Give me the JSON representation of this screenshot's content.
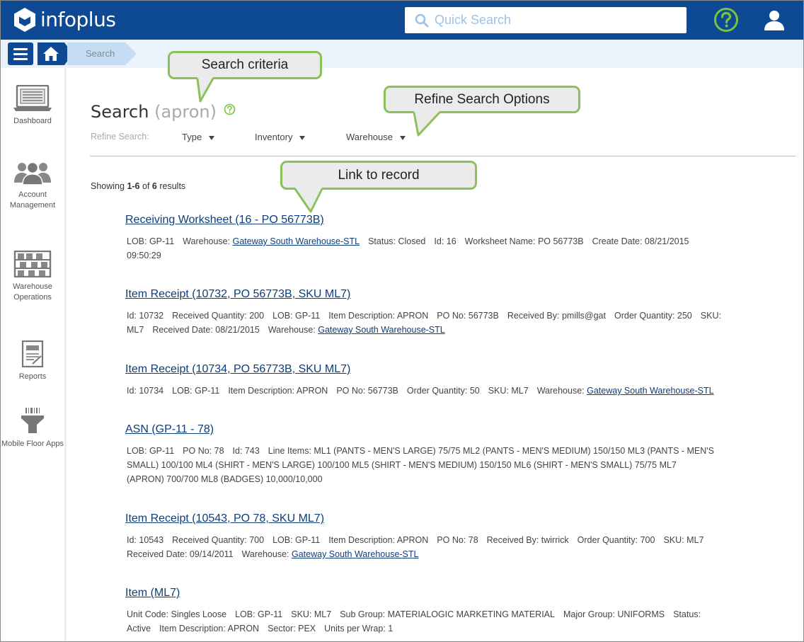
{
  "app": {
    "logo_text": "infoplus"
  },
  "header": {
    "search_placeholder": "Quick Search"
  },
  "breadcrumb": {
    "current": "Search"
  },
  "sidebar": {
    "items": [
      {
        "label": "Dashboard"
      },
      {
        "label": "Account Management"
      },
      {
        "label": "Warehouse Operations"
      },
      {
        "label": "Reports"
      },
      {
        "label": "Mobile Floor Apps"
      }
    ]
  },
  "page": {
    "title": "Search",
    "search_term": "(apron)",
    "refine_label": "Refine Search:",
    "refine_options": [
      "Type",
      "Inventory",
      "Warehouse"
    ],
    "showing": {
      "prefix": "Showing",
      "range": "1-6",
      "of": "of",
      "total": "6",
      "suffix": "results"
    }
  },
  "results": [
    {
      "title": "Receiving Worksheet (16 - PO 56773B)",
      "line1": [
        {
          "text": "LOB: GP-11"
        },
        {
          "label": "Warehouse:",
          "link": "Gateway South Warehouse-STL"
        },
        {
          "text": "Status: Closed"
        },
        {
          "text": "Id: 16"
        },
        {
          "text": "Worksheet Name: PO 56773B"
        },
        {
          "text": "Create Date: 08/21/2015"
        }
      ],
      "line2": [
        {
          "text": "09:50:29"
        }
      ]
    },
    {
      "title": "Item Receipt (10732, PO 56773B, SKU ML7)",
      "line1": [
        {
          "text": "Id: 10732"
        },
        {
          "text": "Received Quantity: 200"
        },
        {
          "text": "LOB: GP-11"
        },
        {
          "text": "Item Description: APRON"
        },
        {
          "text": "PO No: 56773B"
        },
        {
          "text": "Received By: pmills@gat"
        },
        {
          "text": "Order Quantity: 250"
        },
        {
          "text": "SKU:"
        }
      ],
      "line2": [
        {
          "text": "ML7"
        },
        {
          "text": "Received Date: 08/21/2015"
        },
        {
          "label": "Warehouse:",
          "link": "Gateway South Warehouse-STL"
        }
      ]
    },
    {
      "title": "Item Receipt (10734, PO 56773B, SKU ML7)",
      "line1": [
        {
          "text": "Id: 10734"
        },
        {
          "text": "LOB: GP-11"
        },
        {
          "text": "Item Description: APRON"
        },
        {
          "text": "PO No: 56773B"
        },
        {
          "text": "Order Quantity: 50"
        },
        {
          "text": "SKU: ML7"
        },
        {
          "label": "Warehouse:",
          "link": "Gateway South Warehouse-STL"
        }
      ]
    },
    {
      "title": "ASN (GP-11 - 78)",
      "line1": [
        {
          "text": "LOB: GP-11"
        },
        {
          "text": "PO No: 78"
        },
        {
          "text": "Id: 743"
        },
        {
          "text": "Line Items: ML1 (PANTS - MEN'S LARGE) 75/75 ML2 (PANTS - MEN'S MEDIUM) 150/150 ML3 (PANTS - MEN'S"
        }
      ],
      "line2": [
        {
          "text": "SMALL) 100/100 ML4 (SHIRT - MEN'S LARGE) 100/100 ML5 (SHIRT - MEN'S MEDIUM) 150/150 ML6 (SHIRT - MEN'S SMALL) 75/75 ML7"
        }
      ],
      "line3": [
        {
          "text": "(APRON) 700/700 ML8 (BADGES) 10,000/10,000"
        }
      ]
    },
    {
      "title": "Item Receipt (10543, PO 78, SKU ML7)",
      "line1": [
        {
          "text": "Id: 10543"
        },
        {
          "text": "Received Quantity: 700"
        },
        {
          "text": "LOB: GP-11"
        },
        {
          "text": "Item Description: APRON"
        },
        {
          "text": "PO No: 78"
        },
        {
          "text": "Received By: twirrick"
        },
        {
          "text": "Order Quantity: 700"
        },
        {
          "text": "SKU: ML7"
        }
      ],
      "line2": [
        {
          "text": "Received Date: 09/14/2011"
        },
        {
          "label": "Warehouse:",
          "link": "Gateway South Warehouse-STL"
        }
      ]
    },
    {
      "title": "Item (ML7)",
      "line1": [
        {
          "text": "Unit Code: Singles Loose"
        },
        {
          "text": "LOB: GP-11"
        },
        {
          "text": "SKU: ML7"
        },
        {
          "text": "Sub Group: MATERIALOGIC MARKETING MATERIAL"
        },
        {
          "text": "Major Group: UNIFORMS"
        },
        {
          "text": "Status:"
        }
      ],
      "line2": [
        {
          "text": "Active"
        },
        {
          "text": "Item Description: APRON"
        },
        {
          "text": "Sector: PEX"
        },
        {
          "text": "Units per Wrap: 1"
        }
      ]
    }
  ],
  "callouts": {
    "search_criteria": "Search criteria",
    "refine_options": "Refine Search Options",
    "link_to_record": "Link to record"
  },
  "colors": {
    "brand": "#0d4a93",
    "link": "#0d3d7a",
    "callout_border": "#8cc05b",
    "help_green": "#7ac143"
  }
}
